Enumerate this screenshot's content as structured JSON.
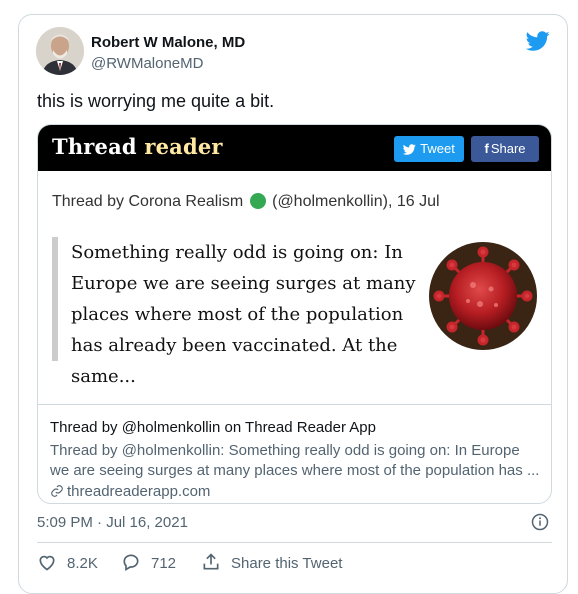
{
  "author": {
    "name": "Robert W Malone, MD",
    "handle": "@RWMaloneMD"
  },
  "tweet_text": "this is worrying me quite a bit.",
  "card": {
    "image": {
      "logo_part1": "Thread",
      "logo_part2": "reader",
      "tweet_button": "Tweet",
      "share_button": "Share",
      "thread_by_prefix": "Thread by Corona Realism",
      "thread_by_suffix": "(@holmenkollin), 16 Jul",
      "quote": "Something really odd is going on: In Europe we are seeing surges at many places where most of the population has already been vaccinated. At the same..."
    },
    "title": "Thread by @holmenkollin on Thread Reader App",
    "description": "Thread by @holmenkollin: Something really odd is going on: In Europe we are seeing surges at many places where most of the population has ...",
    "domain": "threadreaderapp.com"
  },
  "timestamp": "5:09 PM · Jul 16, 2021",
  "actions": {
    "likes": "8.2K",
    "replies": "712",
    "share_label": "Share this Tweet"
  },
  "colors": {
    "twitter_blue": "#1d9bf0",
    "facebook_blue": "#3b5998",
    "secondary_text": "#536471",
    "border": "#cfd9de"
  }
}
